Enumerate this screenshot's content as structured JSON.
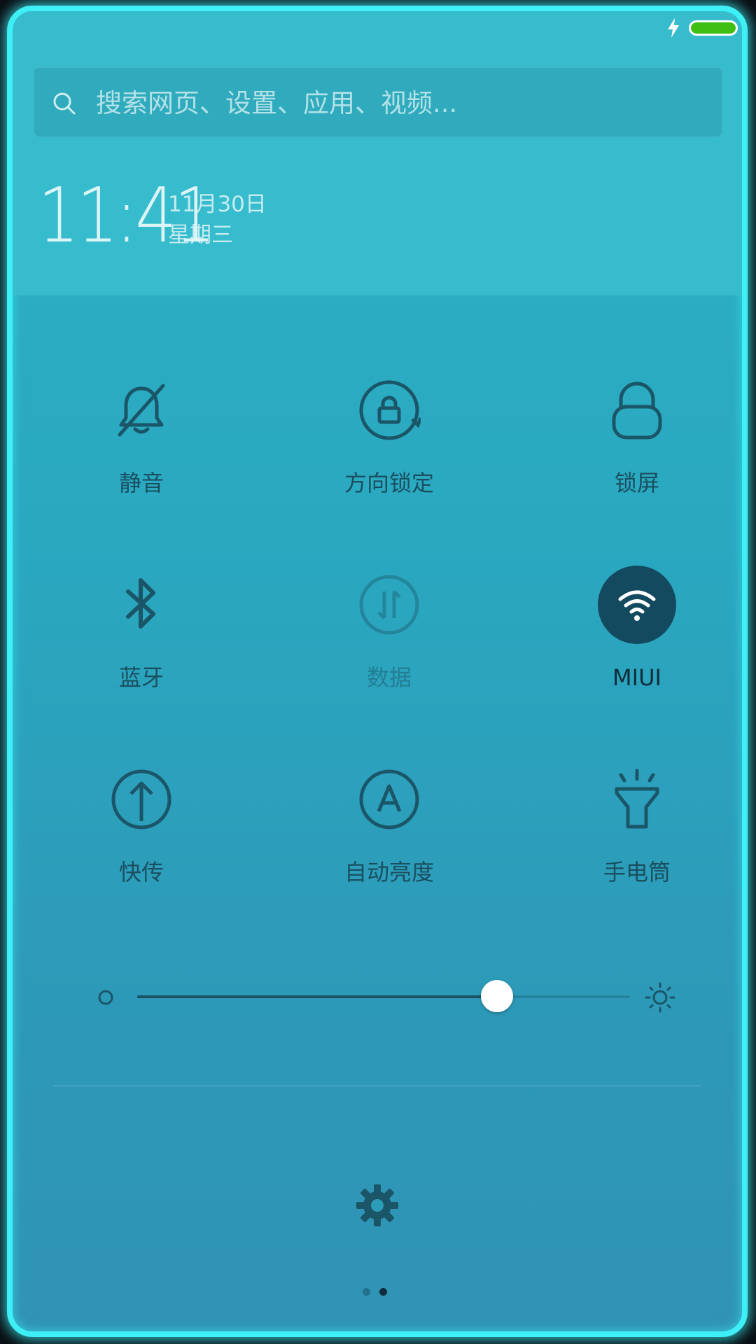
{
  "status_bar": {
    "charging_icon": "lightning-icon",
    "battery_color": "#3fbf14"
  },
  "search": {
    "placeholder": "搜索网页、设置、应用、视频..."
  },
  "clock": {
    "time": "11:41",
    "date": "11月30日",
    "weekday": "星期三"
  },
  "toggles": [
    {
      "label": "静音",
      "icon": "bell-off-icon",
      "state": "off"
    },
    {
      "label": "方向锁定",
      "icon": "rotation-lock-icon",
      "state": "off"
    },
    {
      "label": "锁屏",
      "icon": "lock-icon",
      "state": "off"
    },
    {
      "label": "蓝牙",
      "icon": "bluetooth-icon",
      "state": "off"
    },
    {
      "label": "数据",
      "icon": "mobile-data-icon",
      "state": "disabled"
    },
    {
      "label": "MIUI",
      "icon": "wifi-icon",
      "state": "on"
    },
    {
      "label": "快传",
      "icon": "upload-arrow-icon",
      "state": "off"
    },
    {
      "label": "自动亮度",
      "icon": "auto-brightness-icon",
      "state": "off"
    },
    {
      "label": "手电筒",
      "icon": "flashlight-icon",
      "state": "off"
    }
  ],
  "brightness": {
    "level": 0.73,
    "min_icon": "dim-sun-icon",
    "max_icon": "bright-sun-icon"
  },
  "settings": {
    "icon": "gear-icon"
  },
  "page_indicator": {
    "count": 2,
    "current": 2
  },
  "colors": {
    "frame_glow": "#3ef0f5",
    "icon": "#1a5568",
    "active_circle": "#144a5f"
  }
}
